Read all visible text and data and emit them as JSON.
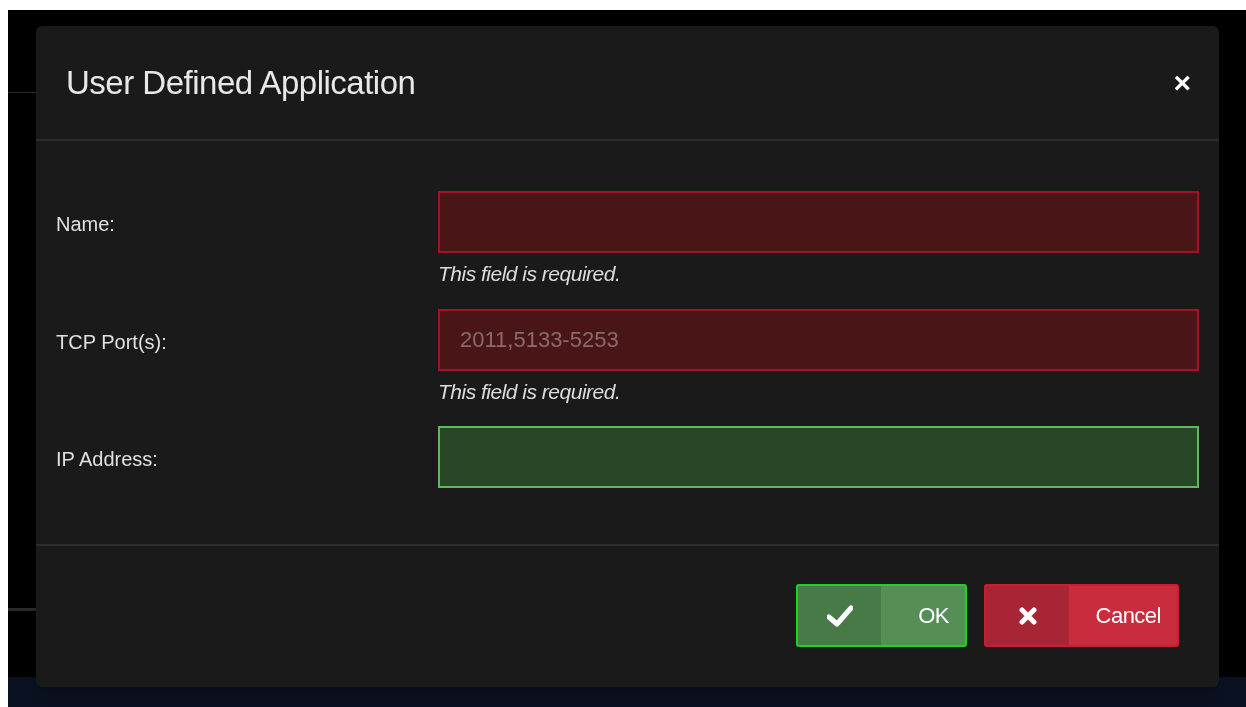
{
  "dialog": {
    "title": "User Defined Application",
    "close": "×"
  },
  "fields": [
    {
      "label": "Name:",
      "invalid": true,
      "error": "This field is required."
    },
    {
      "label": "TCP Port(s):",
      "placeholder": "2011,5133-5253",
      "invalid": true,
      "error": "This field is required."
    },
    {
      "label": "IP Address:",
      "invalid": false
    }
  ],
  "buttons": [
    {
      "label": "OK",
      "kind": "ok"
    },
    {
      "label": "Cancel",
      "kind": "cancel"
    }
  ]
}
